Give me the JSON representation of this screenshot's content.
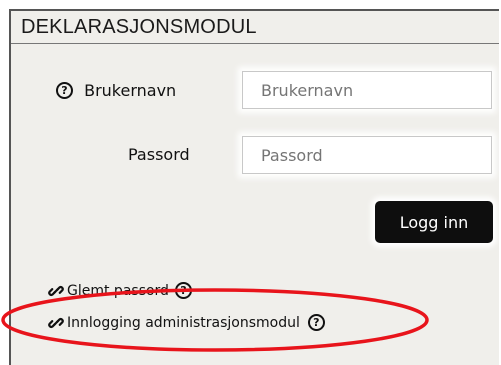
{
  "header": {
    "title": "DEKLARASJONSMODUL"
  },
  "form": {
    "username_label": "Brukernavn",
    "username_placeholder": "Brukernavn",
    "password_label": "Passord",
    "password_placeholder": "Passord",
    "login_label": "Logg inn",
    "help_glyph": "?"
  },
  "links": {
    "forgot_password": "Glemt passord",
    "admin_login": "Innlogging administrasjonsmodul"
  },
  "colors": {
    "panel_bg": "#f0efeb",
    "button_bg": "#0e0e0e",
    "highlight": "#e8141b"
  }
}
